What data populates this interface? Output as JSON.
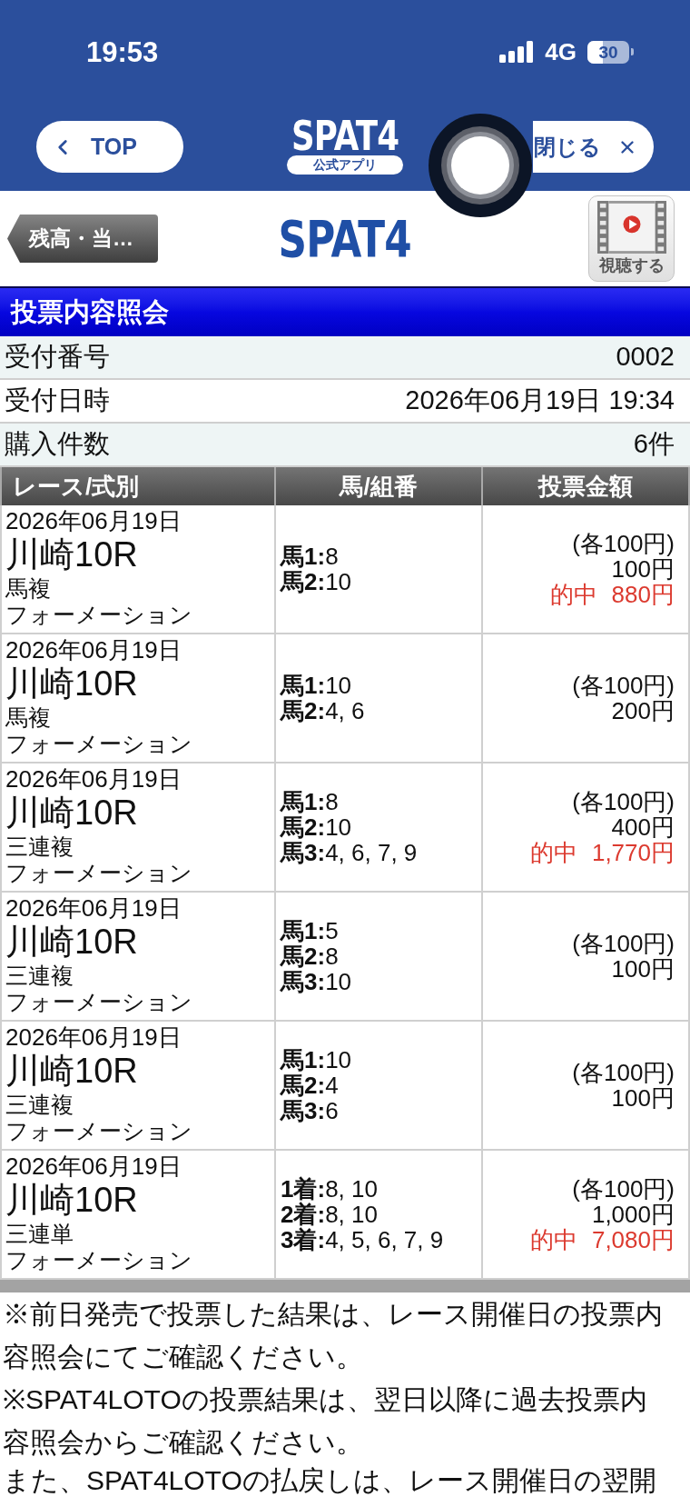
{
  "status_bar": {
    "time": "19:53",
    "network": "4G",
    "battery": "30"
  },
  "nav_bar": {
    "back_button": "TOP",
    "logo": "SPAT4",
    "logo_badge": "公式アプリ",
    "close_button": "閉じる"
  },
  "header": {
    "back_button": "残高・当…",
    "logo": "SPAT4",
    "video_button": "視聴する"
  },
  "page_title": "投票内容照会",
  "summary": [
    {
      "label": "受付番号",
      "value": "0002"
    },
    {
      "label": "受付日時",
      "value": "2026年06月19日 19:34"
    },
    {
      "label": "購入件数",
      "value": "6件"
    }
  ],
  "table": {
    "columns": [
      "レース/式別",
      "馬/組番",
      "投票金額"
    ],
    "rows": [
      {
        "date": "2026年06月19日",
        "race": "川崎10R",
        "bet_type": "馬複",
        "method": "フォーメーション",
        "selections": [
          "**馬1:**8",
          "**馬2:**10"
        ],
        "unit": "(各100円)",
        "amount": "100円",
        "result": {
          "label": "的中",
          "payout": "880円"
        }
      },
      {
        "date": "2026年06月19日",
        "race": "川崎10R",
        "bet_type": "馬複",
        "method": "フォーメーション",
        "selections": [
          "**馬1:**10",
          "**馬2:**4, 6"
        ],
        "unit": "(各100円)",
        "amount": "200円"
      },
      {
        "date": "2026年06月19日",
        "race": "川崎10R",
        "bet_type": "三連複",
        "method": "フォーメーション",
        "selections": [
          "**馬1:**8",
          "**馬2:**10",
          "**馬3:**4, 6, 7, 9"
        ],
        "unit": "(各100円)",
        "amount": "400円",
        "result": {
          "label": "的中",
          "payout": "1,770円"
        }
      },
      {
        "date": "2026年06月19日",
        "race": "川崎10R",
        "bet_type": "三連複",
        "method": "フォーメーション",
        "selections": [
          "**馬1:**5",
          "**馬2:**8",
          "**馬3:**10"
        ],
        "unit": "(各100円)",
        "amount": "100円"
      },
      {
        "date": "2026年06月19日",
        "race": "川崎10R",
        "bet_type": "三連複",
        "method": "フォーメーション",
        "selections": [
          "**馬1:**10",
          "**馬2:**4",
          "**馬3:**6"
        ],
        "unit": "(各100円)",
        "amount": "100円"
      },
      {
        "date": "2026年06月19日",
        "race": "川崎10R",
        "bet_type": "三連単",
        "method": "フォーメーション",
        "selections": [
          "**1着:**8, 10",
          "**2着:**8, 10",
          "**3着:**4, 5, 6, 7, 9"
        ],
        "unit": "(各100円)",
        "amount": "1,000円",
        "result": {
          "label": "的中",
          "payout": "7,080円"
        }
      }
    ]
  },
  "notes": [
    "※前日発売で投票した結果は、レース開催日の投票内容照会にてご確認ください。",
    "※SPAT4LOTOの投票結果は、翌日以降に過去投票内容照会からご確認ください。",
    "また、SPAT4LOTOの払戻しは、レース開催日の翌開"
  ]
}
